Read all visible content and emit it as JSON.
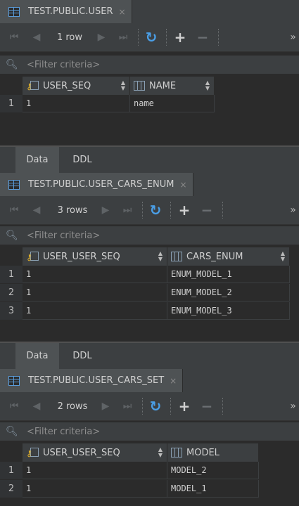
{
  "panels": [
    {
      "tab_title": "TEST.PUBLIC.USER",
      "rows_label": "1 row",
      "filter_placeholder": "<Filter criteria>",
      "columns": [
        "USER_SEQ",
        "NAME"
      ],
      "rows": [
        [
          "1",
          "name"
        ]
      ],
      "row_numbers": [
        "1"
      ]
    },
    {
      "tab_title": "TEST.PUBLIC.USER_CARS_ENUM",
      "rows_label": "3 rows",
      "filter_placeholder": "<Filter criteria>",
      "columns": [
        "USER_USER_SEQ",
        "CARS_ENUM"
      ],
      "rows": [
        [
          "1",
          "ENUM_MODEL_1"
        ],
        [
          "1",
          "ENUM_MODEL_2"
        ],
        [
          "1",
          "ENUM_MODEL_3"
        ]
      ],
      "row_numbers": [
        "1",
        "2",
        "3"
      ]
    },
    {
      "tab_title": "TEST.PUBLIC.USER_CARS_SET",
      "rows_label": "2 rows",
      "filter_placeholder": "<Filter criteria>",
      "columns": [
        "USER_USER_SEQ",
        "MODEL"
      ],
      "rows": [
        [
          "1",
          "MODEL_2"
        ],
        [
          "1",
          "MODEL_1"
        ]
      ],
      "row_numbers": [
        "1",
        "2"
      ]
    }
  ],
  "subtabs": [
    "Data",
    "DDL"
  ],
  "icons": {
    "close": "×",
    "first": "⏮",
    "prev": "◀",
    "next": "▶",
    "last": "⏭",
    "refresh": "↻",
    "add": "+",
    "remove": "−",
    "more": "»",
    "filter": "filter-icon"
  }
}
